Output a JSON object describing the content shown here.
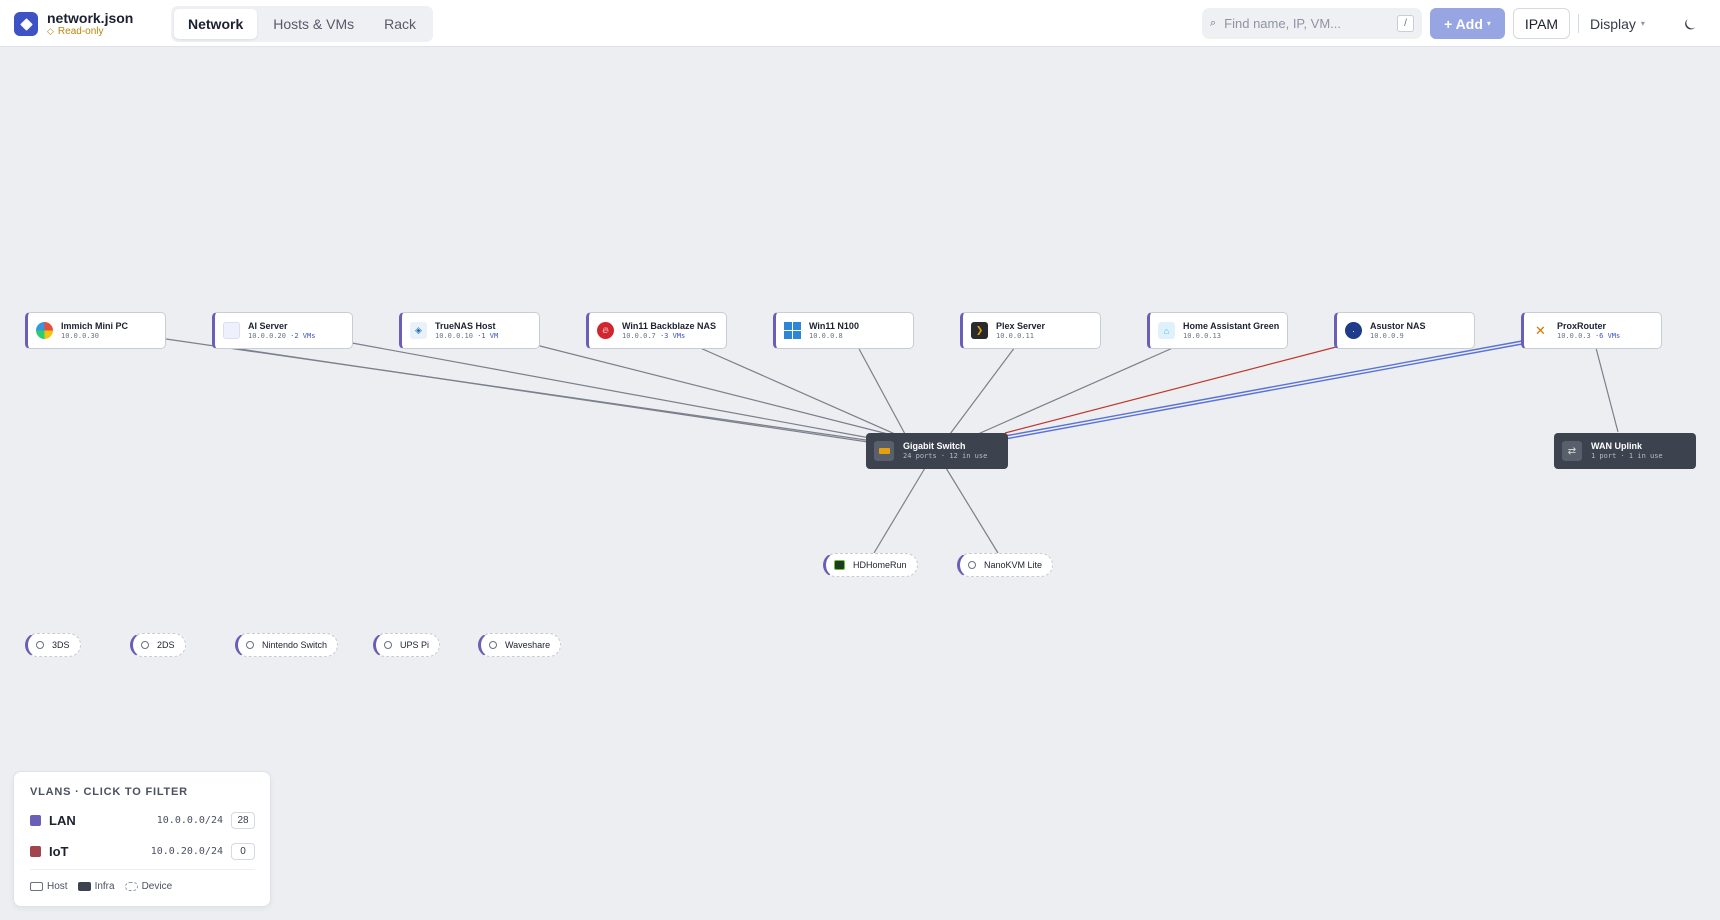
{
  "app": {
    "filename": "network.json",
    "mode": "Read-only"
  },
  "tabs": [
    {
      "label": "Network",
      "active": true
    },
    {
      "label": "Hosts & VMs",
      "active": false
    },
    {
      "label": "Rack",
      "active": false
    }
  ],
  "search": {
    "placeholder": "Find name, IP, VM...",
    "shortcut": "/"
  },
  "toolbar": {
    "add_label": "+ Add",
    "ipam_label": "IPAM",
    "display_label": "Display"
  },
  "hosts": [
    {
      "name": "Immich Mini PC",
      "ip": "10.0.0.30",
      "vms": "",
      "icon": "immich-icon"
    },
    {
      "name": "AI Server",
      "ip": "10.0.0.20",
      "vms": "·2 VMs",
      "icon": "server-icon"
    },
    {
      "name": "TrueNAS Host",
      "ip": "10.0.0.10",
      "vms": "·1 VM",
      "icon": "truenas-icon"
    },
    {
      "name": "Win11 Backblaze NAS",
      "ip": "10.0.0.7",
      "vms": "·3 VMs",
      "icon": "backblaze-icon"
    },
    {
      "name": "Win11 N100",
      "ip": "10.0.0.8",
      "vms": "",
      "icon": "windows-icon"
    },
    {
      "name": "Plex Server",
      "ip": "10.0.0.11",
      "vms": "",
      "icon": "plex-icon"
    },
    {
      "name": "Home Assistant Green",
      "ip": "10.0.0.13",
      "vms": "",
      "icon": "home-assistant-icon"
    },
    {
      "name": "Asustor NAS",
      "ip": "10.0.0.9",
      "vms": "",
      "icon": "asustor-icon"
    },
    {
      "name": "ProxRouter",
      "ip": "10.0.0.3",
      "vms": "·6 VMs",
      "icon": "proxmox-icon"
    }
  ],
  "infra": [
    {
      "name": "Gigabit Switch",
      "sub": "24 ports · 12 in use",
      "icon": "switch-icon"
    },
    {
      "name": "WAN Uplink",
      "sub": "1 port · 1 in use",
      "icon": "uplink-icon"
    }
  ],
  "connected_devices": [
    {
      "name": "HDHomeRun",
      "icon": "hdhomerun-icon"
    },
    {
      "name": "NanoKVM Lite",
      "icon": "device-ring-icon"
    }
  ],
  "unconnected_devices": [
    {
      "name": "3DS"
    },
    {
      "name": "2DS"
    },
    {
      "name": "Nintendo Switch"
    },
    {
      "name": "UPS Pi"
    },
    {
      "name": "Waveshare"
    }
  ],
  "vlan_panel": {
    "title": "VLANS · CLICK TO FILTER",
    "vlans": [
      {
        "name": "LAN",
        "cidr": "10.0.0.0/24",
        "count": "28",
        "color": "#6a5fb6"
      },
      {
        "name": "IoT",
        "cidr": "10.0.20.0/24",
        "count": "0",
        "color": "#a0444d"
      }
    ],
    "legend": [
      {
        "label": "Host"
      },
      {
        "label": "Infra"
      },
      {
        "label": "Device"
      }
    ]
  },
  "colors": {
    "accent": "#3d52c4",
    "lan": "#6a5fb6",
    "iot_link": "#c0392b",
    "trunk_link": "#5a72d6",
    "link": "#7a808c"
  }
}
